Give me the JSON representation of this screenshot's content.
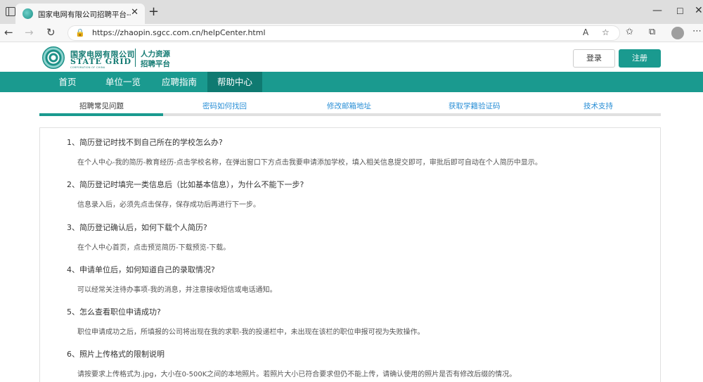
{
  "browser": {
    "tab_title": "国家电网有限公司招聘平台--帮助",
    "tab_close": "✕",
    "new_tab": "+",
    "url": "https://zhaopin.sgcc.com.cn/helpCenter.html",
    "nav": {
      "back": "←",
      "forward": "→",
      "reload": "↻"
    },
    "window": {
      "minimize": "—",
      "maximize": "☐",
      "close": "✕"
    },
    "icons": {
      "lock": "🔒",
      "read_aloud": "A",
      "favorite": "☆",
      "favorites": "✩",
      "collections": "⧉",
      "more": "⋯"
    }
  },
  "logo": {
    "cn": "国家电网有限公司",
    "en": "STATE GRID",
    "sub": "CORPORATION OF CHINA",
    "title_line1": "人力资源",
    "title_line2": "招聘平台"
  },
  "header": {
    "login_label": "登录",
    "register_label": "注册"
  },
  "mainnav": [
    "首页",
    "单位一览",
    "应聘指南",
    "帮助中心"
  ],
  "subtabs": [
    "招聘常见问题",
    "密码如何找回",
    "修改邮箱地址",
    "获取学籍验证码",
    "技术支持"
  ],
  "faq": [
    {
      "q": "1、简历登记时找不到自己所在的学校怎么办?",
      "a": "在个人中心-我的简历-教育经历-点击学校名称，在弹出窗口下方点击我要申请添加学校，填入相关信息提交即可，审批后即可自动在个人简历中显示。"
    },
    {
      "q": "2、简历登记时填完一类信息后（比如基本信息），为什么不能下一步?",
      "a": "信息录入后，必须先点击保存，保存成功后再进行下一步。"
    },
    {
      "q": "3、简历登记确认后，如何下载个人简历?",
      "a": "在个人中心首页，点击预览简历-下载预览-下载。"
    },
    {
      "q": "4、申请单位后，如何知道自己的录取情况?",
      "a": "可以经常关注待办事项-我的消息，并注意接收短信或电话通知。"
    },
    {
      "q": "5、怎么查看职位申请成功?",
      "a": "职位申请成功之后，所填报的公司将出现在我的求职-我的投递栏中，未出现在该栏的职位申报可视为失败操作。"
    },
    {
      "q": "6、照片上传格式的限制说明",
      "a": "请按要求上传格式为.jpg，大小在0-500K之间的本地照片。若照片大小已符合要求但仍不能上传，请确认使用的照片是否有修改后缀的情况。"
    }
  ]
}
